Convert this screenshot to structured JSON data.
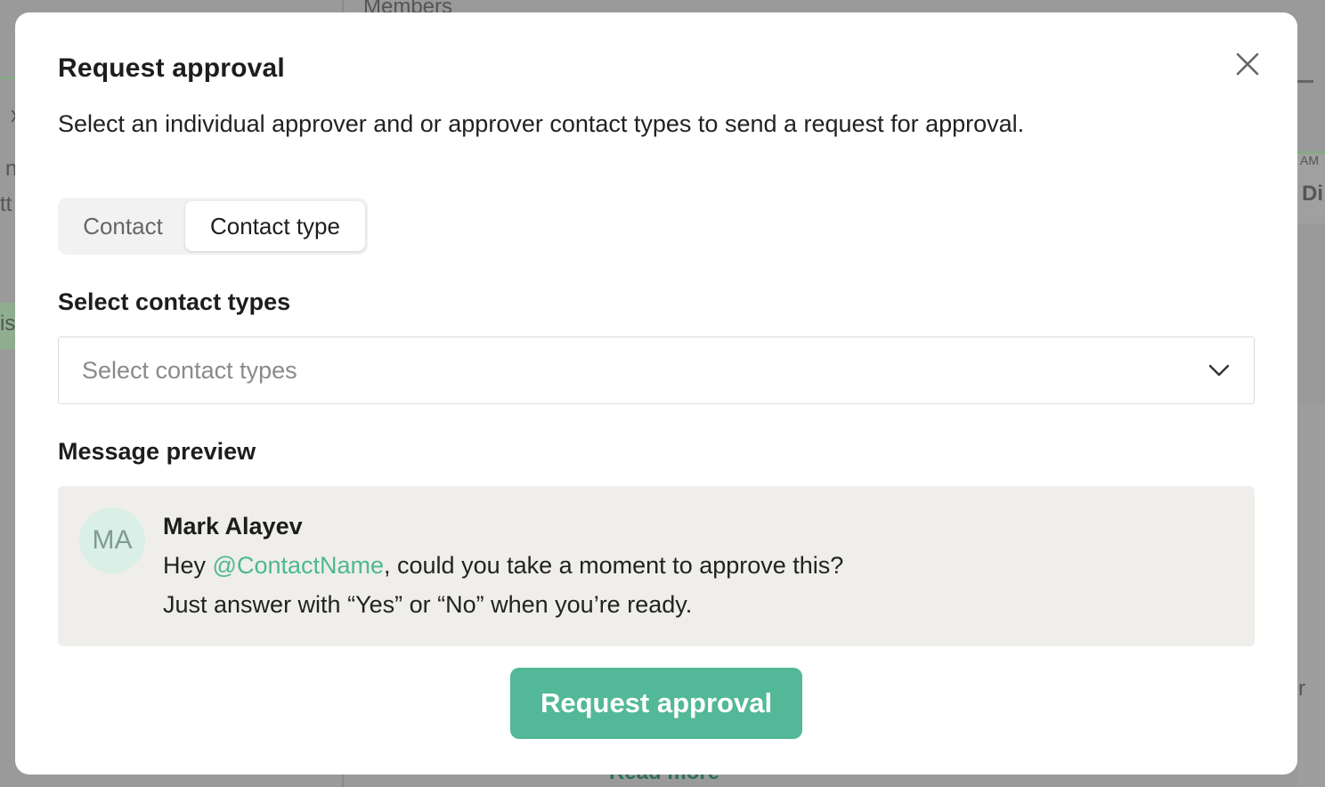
{
  "background": {
    "members_label": "Members",
    "read_more_label": "Read more",
    "left_fragments": [
      "x",
      "n",
      "tt",
      "is"
    ],
    "right_fragments": [
      "AM",
      "Di",
      "r"
    ]
  },
  "modal": {
    "title": "Request approval",
    "description": "Select an individual approver and or approver contact types to send a request for approval.",
    "close_icon": "close-icon",
    "segmented_control": {
      "options": [
        "Contact",
        "Contact type"
      ],
      "selected": "Contact type"
    },
    "contact_types": {
      "label": "Select contact types",
      "placeholder": "Select contact types",
      "chevron_icon": "chevron-down-icon"
    },
    "message_preview": {
      "label": "Message preview",
      "avatar_initials": "MA",
      "sender_name": "Mark Alayev",
      "line1_prefix": "Hey ",
      "mention": "@ContactName",
      "line1_suffix": ", could you take a moment to approve this?",
      "line2": "Just answer with “Yes” or “No” when you’re ready."
    },
    "submit_label": "Request approval"
  },
  "colors": {
    "accent": "#53b897",
    "mention": "#4db893",
    "avatar_bg": "#d9efe7",
    "preview_bg": "#efeeeb",
    "overlay": "#9a9a9a"
  }
}
